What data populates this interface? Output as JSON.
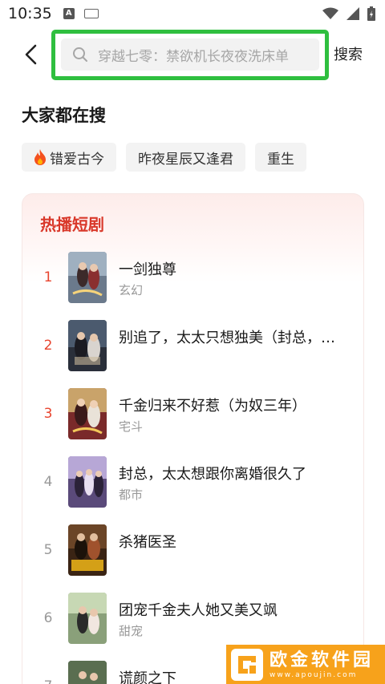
{
  "status": {
    "time": "10:35",
    "a_badge": "A"
  },
  "search": {
    "placeholder": "穿越七零：禁欲机长夜夜洗床单",
    "button_label": "搜索"
  },
  "trending": {
    "title": "大家都在搜",
    "chips": [
      {
        "label": "错爱古今",
        "hot": true
      },
      {
        "label": "昨夜星辰又逢君",
        "hot": false
      },
      {
        "label": "重生",
        "hot": false
      }
    ]
  },
  "hot_dramas": {
    "title": "热播短剧",
    "items": [
      {
        "rank": "1",
        "title": "一剑独尊",
        "tag": "玄幻",
        "top": true
      },
      {
        "rank": "2",
        "title": "别追了，太太只想独美（封总，…",
        "tag": "",
        "top": true
      },
      {
        "rank": "3",
        "title": "千金归来不好惹（为奴三年）",
        "tag": "宅斗",
        "top": true
      },
      {
        "rank": "4",
        "title": "封总，太太想跟你离婚很久了",
        "tag": "都市",
        "top": false
      },
      {
        "rank": "5",
        "title": "杀猪医圣",
        "tag": "",
        "top": false
      },
      {
        "rank": "6",
        "title": "团宠千金夫人她又美又飒",
        "tag": "甜宠",
        "top": false
      },
      {
        "rank": "7",
        "title": "谎颜之下",
        "tag": "",
        "top": false
      }
    ]
  },
  "watermark": {
    "name": "欧金软件园",
    "url": "www.apoujin.com"
  },
  "colors": {
    "highlight": "#2fbf3f",
    "accent_red": "#d9382a",
    "watermark": "#f7a21b"
  }
}
